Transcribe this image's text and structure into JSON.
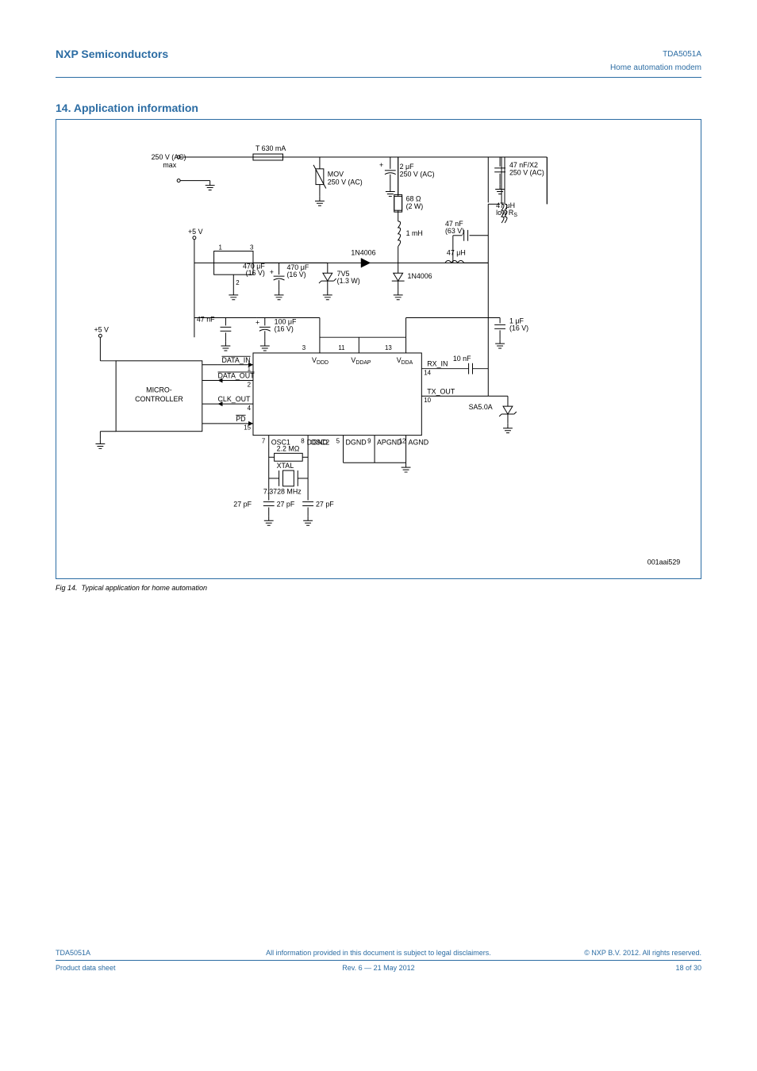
{
  "header": {
    "company": "NXP Semiconductors",
    "part": "TDA5051A",
    "desc": "Home automation modem"
  },
  "section_no": "14.",
  "section_title": "Application information",
  "figure": {
    "caption_no": "Fig 14.",
    "caption": "Typical application for home automation",
    "drawing_id": "001aai529"
  },
  "labels": {
    "ac_in": "250 V (AC)\nmax",
    "fuse": "T 630 mA",
    "mov": "MOV\n250 V (AC)",
    "c_2uf": "2 µF\n250 V (AC)",
    "c_47nf_x2": "47 nF/X2\n250 V (AC)",
    "r_68": "68 Ω\n(2 W)",
    "l_47uh_lowrs": "47 µH\nlow R",
    "l_47uh_lowrs_sub": "S",
    "l_1mh": "1 mH",
    "c_47nf_63v": "47 nF\n(63 V)",
    "l_47uh": "47 µH",
    "d1": "1N4006",
    "d2": "1N4006",
    "z_7v5": "7V5\n(1.3 W)",
    "c_470uf": "470 µF\n(16 V)",
    "c_100uf": "100 µF\n(16 V)",
    "c_47nf": "47 nF",
    "c_1uf": "1 µF\n(16 V)",
    "c_10nf": "10 nF",
    "sa50a": "SA5.0A",
    "v5": "+5 V",
    "micro": "MICRO-\nCONTROLLER",
    "data_in": "DATA_IN",
    "data_out": "DATA_OUT",
    "clk_out": "CLK_OUT",
    "pd": "PD",
    "vddd": "V",
    "vddd_sub": "DDD",
    "vddap": "V",
    "vddap_sub": "DDAP",
    "vdda": "V",
    "vdda_sub": "DDA",
    "rx_in": "RX_IN",
    "tx_out": "TX_OUT",
    "osc1": "OSC1",
    "osc2": "OSC2",
    "dgnd": "DGND",
    "apgnd": "APGND",
    "agnd": "AGND",
    "r_22m": "2.2 MΩ",
    "xtal": "XTAL\n7.3728 MHz",
    "c_27pf": "27 pF",
    "p1": "1",
    "p2": "2",
    "p3": "3",
    "p4": "4",
    "p5": "5",
    "p7": "7",
    "p8": "8",
    "p9": "9",
    "p10": "10",
    "p11": "11",
    "p12": "12",
    "p13": "13",
    "p14": "14",
    "p15": "15"
  },
  "footer": {
    "doc_id": "TDA5051A",
    "note": "All information provided in this document is subject to legal disclaimers.",
    "copyright": "© NXP B.V. 2012. All rights reserved.",
    "ds": "Product data sheet",
    "rev": "Rev. 6 — 21 May 2012",
    "page": "18 of 30"
  }
}
